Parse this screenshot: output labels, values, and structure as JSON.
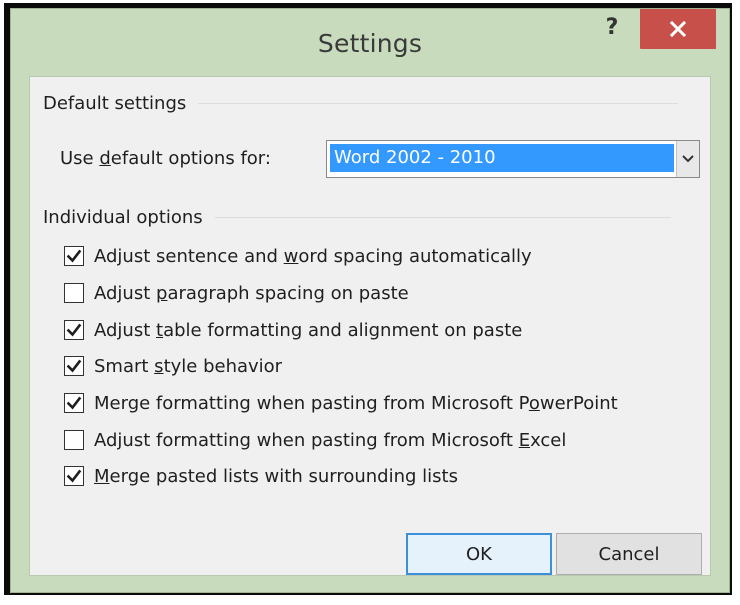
{
  "window": {
    "title": "Settings",
    "help_label": "?",
    "close_icon": "close-icon"
  },
  "default_settings": {
    "group_label": "Default settings",
    "use_default_label_before": "Use ",
    "use_default_label_accel": "d",
    "use_default_label_after": "efault options for:",
    "dropdown_value": "Word 2002 - 2010"
  },
  "individual_options": {
    "group_label": "Individual options",
    "items": [
      {
        "before": "Adjust sentence and ",
        "accel": "w",
        "after": "ord spacing automatically",
        "checked": true
      },
      {
        "before": "Adjust ",
        "accel": "p",
        "after": "aragraph spacing on paste",
        "checked": false
      },
      {
        "before": "Adjust ",
        "accel": "t",
        "after": "able formatting and alignment on paste",
        "checked": true
      },
      {
        "before": "Smart ",
        "accel": "s",
        "after": "tyle behavior",
        "checked": true
      },
      {
        "before": "Merge formatting when pasting from Microsoft P",
        "accel": "o",
        "after": "werPoint",
        "checked": true
      },
      {
        "before": "Adjust formatting when pasting from Microsoft ",
        "accel": "E",
        "after": "xcel",
        "checked": false
      },
      {
        "before": "",
        "accel": "M",
        "after": "erge pasted lists with surrounding lists",
        "checked": true
      }
    ]
  },
  "buttons": {
    "ok_label": "OK",
    "cancel_label": "Cancel"
  },
  "colors": {
    "frame": "#c8dbbd",
    "close_button": "#c7504a",
    "selection": "#3399ff",
    "default_button_border": "#3c8fd9"
  }
}
